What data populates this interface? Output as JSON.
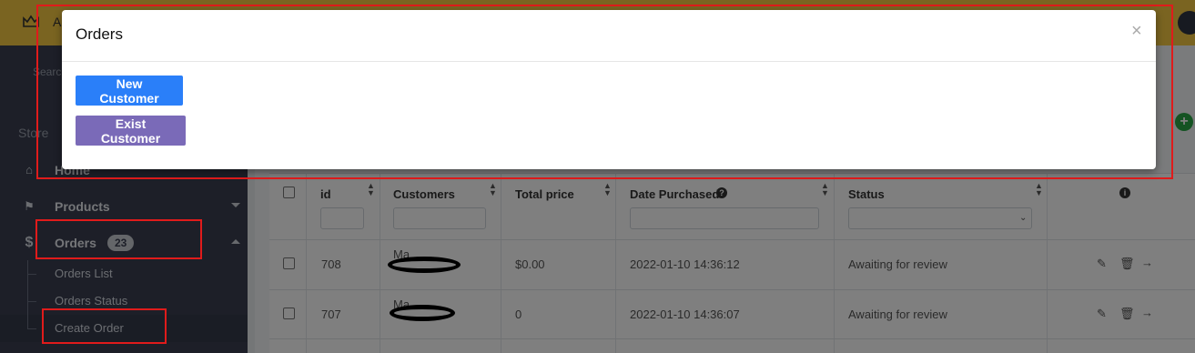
{
  "topbar": {
    "brand_letter": "A",
    "icons": [
      "crown-icon",
      "user-avatar-icon"
    ],
    "color": "#f5c842"
  },
  "sidebar": {
    "search_label": "Search",
    "section_label": "Store",
    "items": [
      {
        "label": "Home",
        "icon": "home-icon"
      },
      {
        "label": "Products",
        "icon": "tag-icon"
      },
      {
        "label": "Orders",
        "icon": "dollar-icon",
        "badge": "23"
      }
    ],
    "sub_items": [
      {
        "label": "Orders List"
      },
      {
        "label": "Orders Status"
      },
      {
        "label": "Create Order"
      }
    ]
  },
  "table": {
    "headers": [
      "id",
      "Customers",
      "Total price",
      "Date Purchased",
      "Status"
    ],
    "rows": [
      {
        "id": "708",
        "customer": "Ma...",
        "total": "$0.00",
        "date": "2022-01-10 14:36:12",
        "status": "Awaiting for review"
      },
      {
        "id": "707",
        "customer": "Ma...",
        "total": "0",
        "date": "2022-01-10 14:36:07",
        "status": "Awaiting for review"
      }
    ],
    "action_icons": [
      "edit-icon",
      "trash-icon",
      "arrow-right-icon"
    ]
  },
  "modal": {
    "title": "Orders",
    "close_label": "×",
    "buttons": {
      "new_customer": "New Customer",
      "exist_customer": "Exist Customer"
    }
  },
  "colors": {
    "annotation": "#e01b1b",
    "primary_button": "#2a7ff9",
    "secondary_button": "#7a6ab8",
    "sidebar": "#3a3f51"
  }
}
